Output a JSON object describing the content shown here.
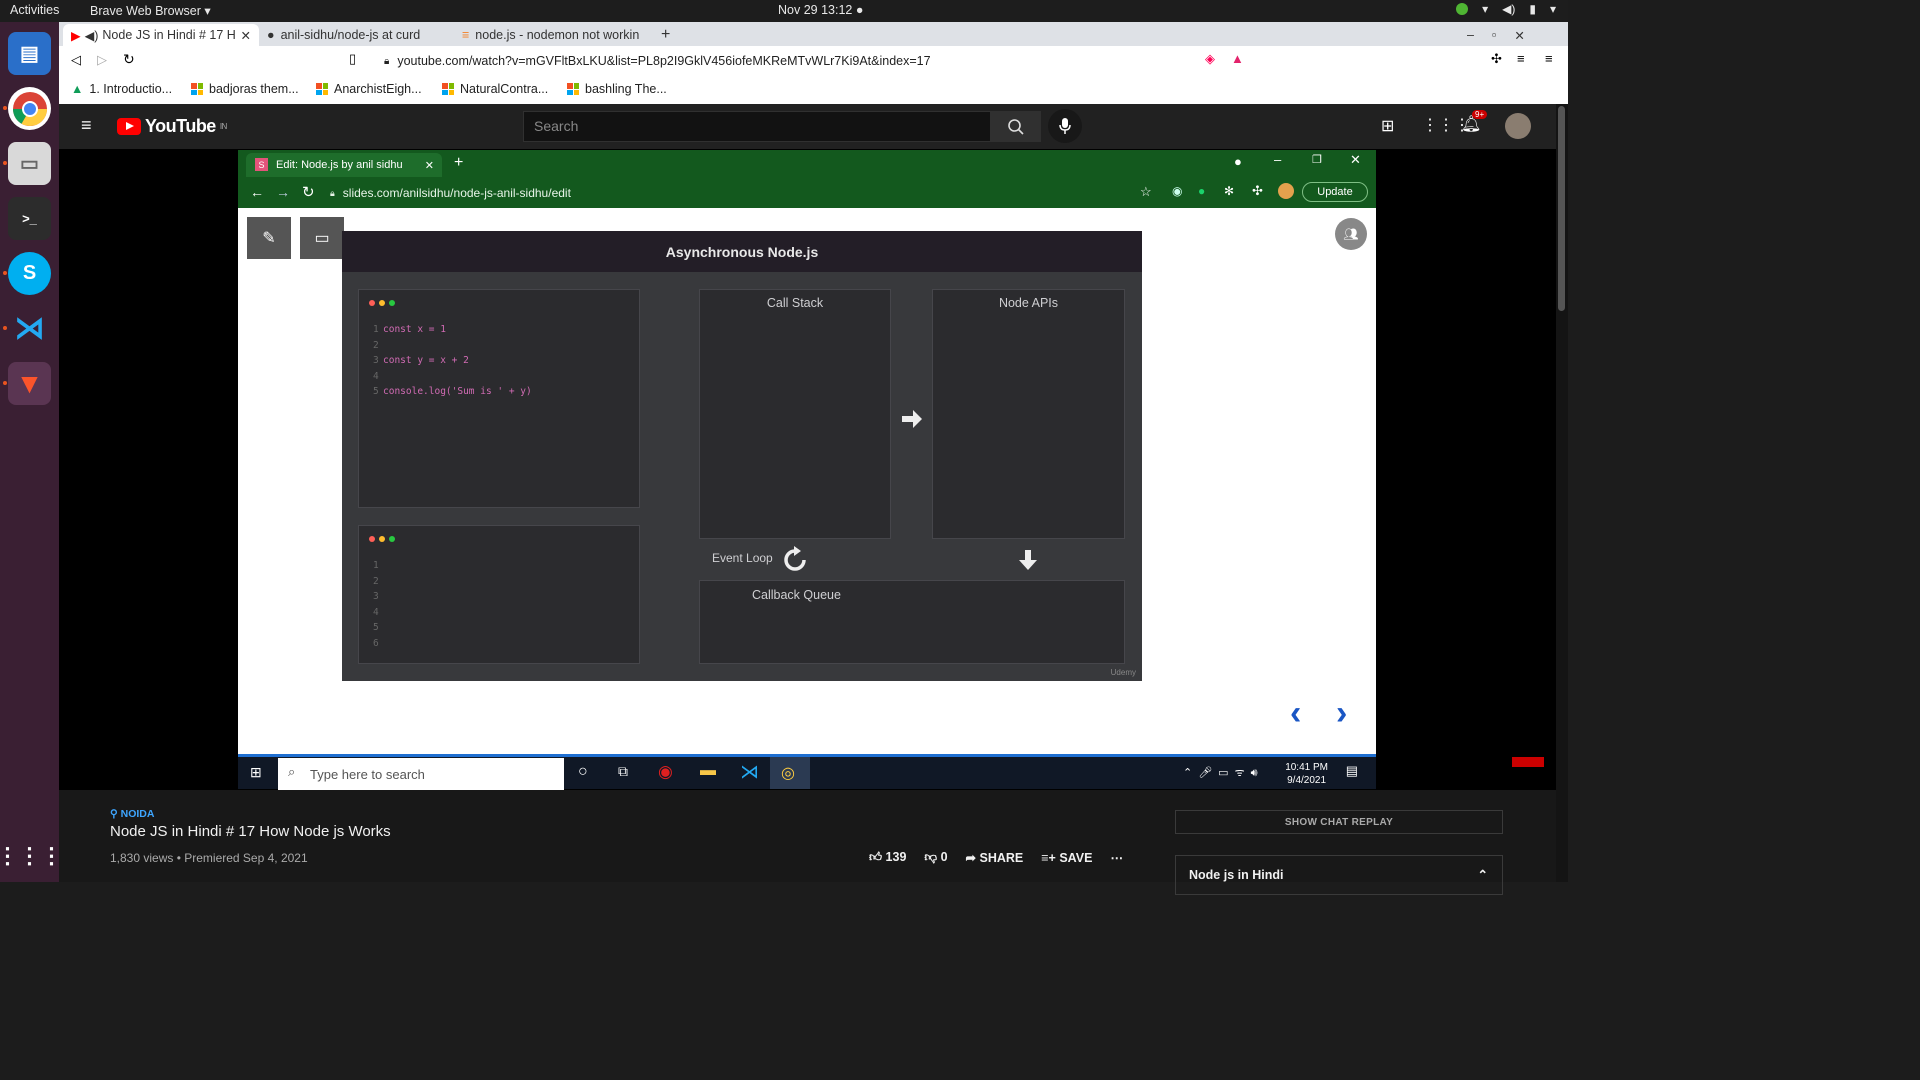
{
  "system_bar": {
    "activities": "Activities",
    "app": "Brave Web Browser ▾",
    "clock": "Nov 29  13:12  ●"
  },
  "browser": {
    "tabs": [
      {
        "label": "Node JS in Hindi # 17 H"
      },
      {
        "label": "anil-sidhu/node-js at curd"
      },
      {
        "label": "node.js - nodemon not workin"
      }
    ],
    "url": "youtube.com/watch?v=mGVFltBxLKU&list=PL8p2I9GklV456iofeMKReMTvWLr7Ki9At&index=17",
    "bookmarks": [
      "1. Introductio...",
      "badjoras them...",
      "AnarchistEigh...",
      "NaturalContra...",
      "bashling The..."
    ]
  },
  "youtube": {
    "logo": "YouTube",
    "region": "IN",
    "search_placeholder": "Search",
    "notifications": "9+"
  },
  "inner_browser": {
    "tab_title": "Edit: Node.js by anil sidhu",
    "url": "slides.com/anilsidhu/node-js-anil-sidhu/edit",
    "update": "Update"
  },
  "slide": {
    "title": "Asynchronous Node.js",
    "code_lines": [
      {
        "n": "1",
        "text": "const x = 1"
      },
      {
        "n": "2",
        "text": ""
      },
      {
        "n": "3",
        "text": "const y = x + 2"
      },
      {
        "n": "4",
        "text": ""
      },
      {
        "n": "5",
        "text": "console.log('Sum is ' + y)"
      }
    ],
    "console_lines": [
      "1",
      "2",
      "3",
      "4",
      "5",
      "6"
    ],
    "call_stack": "Call Stack",
    "node_apis": "Node APIs",
    "event_loop": "Event Loop",
    "callback_queue": "Callback Queue",
    "watermark": "Udemy"
  },
  "windows_taskbar": {
    "search": "Type here to search",
    "time": "10:41 PM",
    "date": "9/4/2021"
  },
  "video_info": {
    "location": "NOIDA",
    "title": "Node JS in Hindi # 17 How Node js Works",
    "meta": "1,830 views • Premiered Sep 4, 2021",
    "likes": "139",
    "dislikes": "0",
    "share": "SHARE",
    "save": "SAVE",
    "chat_replay": "SHOW CHAT REPLAY",
    "playlist_title": "Node js in Hindi"
  }
}
